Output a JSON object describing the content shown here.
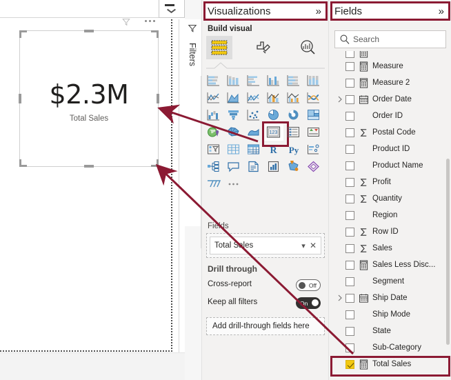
{
  "canvas": {
    "visual": {
      "value": "$2.3M",
      "label": "Total Sales"
    },
    "header_icons": {
      "filter": "filter-funnel-icon",
      "more": "more-options-icon"
    },
    "page_dropdown_icon": "chevron-down-icon"
  },
  "filters_rail": {
    "label": "Filters",
    "icon": "filter-icon"
  },
  "visualizations": {
    "title": "Visualizations",
    "expand_icon": "»",
    "build_visual_label": "Build visual",
    "tabs": [
      {
        "name": "build",
        "icon": "build-visual-icon",
        "selected": true
      },
      {
        "name": "format",
        "icon": "format-paintbrush-icon",
        "selected": false
      },
      {
        "name": "analytics",
        "icon": "analytics-magnifier-icon",
        "selected": false
      }
    ],
    "icon_grid": [
      [
        {
          "name": "stacked-bar-chart-icon",
          "highlighted": false
        },
        {
          "name": "stacked-column-chart-icon",
          "highlighted": false
        },
        {
          "name": "clustered-bar-chart-icon",
          "highlighted": false
        },
        {
          "name": "clustered-column-chart-icon",
          "highlighted": false
        },
        {
          "name": "100-stacked-bar-chart-icon",
          "highlighted": false
        },
        {
          "name": "100-stacked-column-chart-icon",
          "highlighted": false
        }
      ],
      [
        {
          "name": "line-chart-icon",
          "highlighted": false
        },
        {
          "name": "area-chart-icon",
          "highlighted": false
        },
        {
          "name": "stacked-area-chart-icon",
          "highlighted": false
        },
        {
          "name": "line-stacked-column-chart-icon",
          "highlighted": false
        },
        {
          "name": "line-clustered-column-chart-icon",
          "highlighted": false
        },
        {
          "name": "ribbon-chart-icon",
          "highlighted": false
        }
      ],
      [
        {
          "name": "waterfall-chart-icon",
          "highlighted": false
        },
        {
          "name": "funnel-chart-icon",
          "highlighted": false
        },
        {
          "name": "scatter-chart-icon",
          "highlighted": false
        },
        {
          "name": "pie-chart-icon",
          "highlighted": false
        },
        {
          "name": "donut-chart-icon",
          "highlighted": false
        },
        {
          "name": "treemap-icon",
          "highlighted": false
        }
      ],
      [
        {
          "name": "map-icon",
          "highlighted": false
        },
        {
          "name": "filled-map-icon",
          "highlighted": false
        },
        {
          "name": "shape-map-icon",
          "highlighted": false
        },
        {
          "name": "card-icon",
          "highlighted": true
        },
        {
          "name": "multi-row-card-icon",
          "highlighted": false
        },
        {
          "name": "kpi-icon",
          "highlighted": false
        }
      ],
      [
        {
          "name": "slicer-icon",
          "highlighted": false
        },
        {
          "name": "table-icon",
          "highlighted": false
        },
        {
          "name": "matrix-icon",
          "highlighted": false
        },
        {
          "name": "r-script-visual-icon",
          "highlighted": false
        },
        {
          "name": "python-visual-icon",
          "highlighted": false
        },
        {
          "name": "key-influencers-icon",
          "highlighted": false
        }
      ],
      [
        {
          "name": "decomposition-tree-icon",
          "highlighted": false
        },
        {
          "name": "q-and-a-icon",
          "highlighted": false
        },
        {
          "name": "narrative-icon",
          "highlighted": false
        },
        {
          "name": "paginated-report-icon",
          "highlighted": false
        },
        {
          "name": "arcgis-maps-icon",
          "highlighted": false
        },
        {
          "name": "power-apps-icon",
          "highlighted": false
        }
      ],
      [
        {
          "name": "power-automate-icon",
          "highlighted": false
        },
        {
          "name": "more-visuals-icon",
          "highlighted": false
        }
      ]
    ],
    "fields_well": {
      "label": "Fields",
      "chip": "Total Sales",
      "chevron_icon": "chevron-down-icon",
      "remove_icon": "close-icon"
    },
    "drill_through": {
      "title": "Drill through",
      "cross_report": {
        "label": "Cross-report",
        "state": "Off"
      },
      "keep_all_filters": {
        "label": "Keep all filters",
        "state": "On"
      },
      "dropzone": "Add drill-through fields here"
    }
  },
  "fields": {
    "title": "Fields",
    "expand_icon": "»",
    "search": {
      "placeholder": "Search",
      "icon": "search-icon",
      "value": ""
    },
    "items": [
      {
        "label": "",
        "icon": "measure-icon",
        "expander": false,
        "checked": false,
        "clipped": true
      },
      {
        "label": "Measure",
        "icon": "measure-icon",
        "expander": false,
        "checked": false
      },
      {
        "label": "Measure 2",
        "icon": "measure-icon",
        "expander": false,
        "checked": false
      },
      {
        "label": "Order Date",
        "icon": "date-hierarchy-icon",
        "expander": true,
        "checked": false
      },
      {
        "label": "Order ID",
        "icon": "none",
        "expander": false,
        "checked": false
      },
      {
        "label": "Postal Code",
        "icon": "sum-icon",
        "expander": false,
        "checked": false
      },
      {
        "label": "Product ID",
        "icon": "none",
        "expander": false,
        "checked": false
      },
      {
        "label": "Product Name",
        "icon": "none",
        "expander": false,
        "checked": false
      },
      {
        "label": "Profit",
        "icon": "sum-icon",
        "expander": false,
        "checked": false
      },
      {
        "label": "Quantity",
        "icon": "sum-icon",
        "expander": false,
        "checked": false
      },
      {
        "label": "Region",
        "icon": "none",
        "expander": false,
        "checked": false
      },
      {
        "label": "Row ID",
        "icon": "sum-icon",
        "expander": false,
        "checked": false
      },
      {
        "label": "Sales",
        "icon": "sum-icon",
        "expander": false,
        "checked": false
      },
      {
        "label": "Sales Less Disc...",
        "icon": "measure-icon",
        "expander": false,
        "checked": false
      },
      {
        "label": "Segment",
        "icon": "none",
        "expander": false,
        "checked": false
      },
      {
        "label": "Ship Date",
        "icon": "date-hierarchy-icon",
        "expander": true,
        "checked": false
      },
      {
        "label": "Ship Mode",
        "icon": "none",
        "expander": false,
        "checked": false
      },
      {
        "label": "State",
        "icon": "none",
        "expander": false,
        "checked": false
      },
      {
        "label": "Sub-Category",
        "icon": "none",
        "expander": false,
        "checked": false
      },
      {
        "label": "Total Sales",
        "icon": "measure-icon",
        "expander": false,
        "checked": true,
        "highlighted": true
      }
    ]
  },
  "annotations": {
    "accent_color": "#8b1a33",
    "arrows": [
      {
        "name": "card-icon-to-visual",
        "from": "card-visual-icon",
        "to": "card-visual-right-handle"
      },
      {
        "name": "total-sales-field-to-visual",
        "from": "total-sales-field",
        "to": "card-visual-bottom-right-handle"
      }
    ]
  }
}
